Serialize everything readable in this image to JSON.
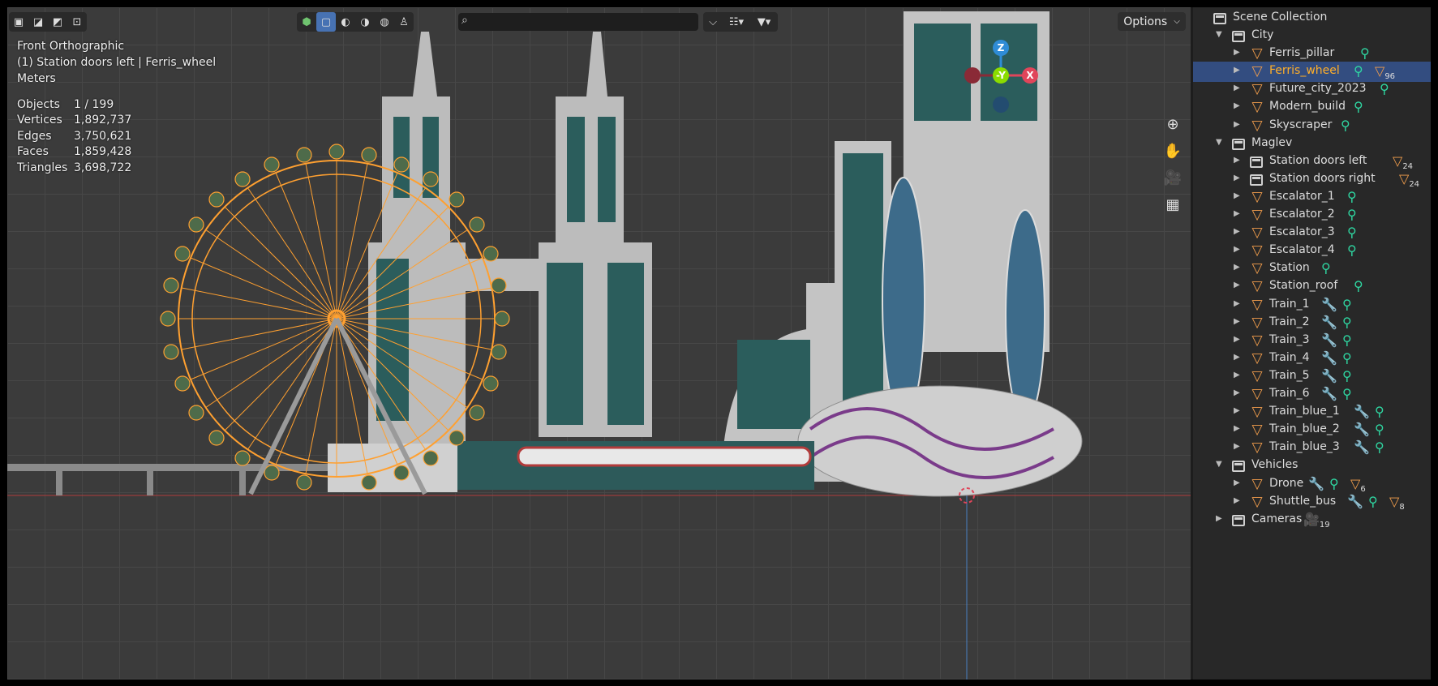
{
  "viewport": {
    "view_name": "Front Orthographic",
    "active_object": "(1) Station doors left | Ferris_wheel",
    "units": "Meters",
    "stats": [
      {
        "label": "Objects",
        "value": "1 / 199"
      },
      {
        "label": "Vertices",
        "value": "1,892,737"
      },
      {
        "label": "Edges",
        "value": "3,750,621"
      },
      {
        "label": "Faces",
        "value": "1,859,428"
      },
      {
        "label": "Triangles",
        "value": "3,698,722"
      }
    ],
    "options_label": "Options",
    "search_placeholder": "",
    "gizmo": {
      "z": "Z",
      "y": "-Y",
      "x": "X"
    },
    "colors": {
      "selection": "#ffa030",
      "background": "#3b3b3b",
      "x_axis": "#e0455a",
      "y_axis": "#8bdc00",
      "z_axis": "#2f8cd6"
    }
  },
  "outliner": {
    "root": "Scene Collection",
    "rows": [
      {
        "label": "City",
        "kind": "collection",
        "depth": 1,
        "expanded": true,
        "tails": []
      },
      {
        "label": "Ferris_pillar",
        "kind": "object",
        "depth": 2,
        "tails": [
          {
            "icon": "mesh-data-icon",
            "color": "green"
          }
        ]
      },
      {
        "label": "Ferris_wheel",
        "kind": "object",
        "depth": 2,
        "selected": true,
        "tails": [
          {
            "icon": "mesh-data-icon",
            "color": "green"
          },
          {
            "icon": "children-icon",
            "color": "orange",
            "count": "96"
          }
        ]
      },
      {
        "label": "Future_city_2023",
        "kind": "object",
        "depth": 2,
        "tails": [
          {
            "icon": "mesh-data-icon",
            "color": "green"
          }
        ]
      },
      {
        "label": "Modern_build",
        "kind": "object",
        "depth": 2,
        "tails": [
          {
            "icon": "mesh-data-icon",
            "color": "green"
          }
        ]
      },
      {
        "label": "Skyscraper",
        "kind": "object",
        "depth": 2,
        "tails": [
          {
            "icon": "mesh-data-icon",
            "color": "green"
          }
        ]
      },
      {
        "label": "Maglev",
        "kind": "collection",
        "depth": 1,
        "expanded": true,
        "tails": []
      },
      {
        "label": "Station doors left",
        "kind": "collection",
        "depth": 2,
        "tails": [
          {
            "icon": "children-icon",
            "color": "orange",
            "count": "24"
          }
        ]
      },
      {
        "label": "Station doors right",
        "kind": "collection",
        "depth": 2,
        "tails": [
          {
            "icon": "children-icon",
            "color": "orange",
            "count": "24"
          }
        ]
      },
      {
        "label": "Escalator_1",
        "kind": "object",
        "depth": 2,
        "tails": [
          {
            "icon": "mesh-data-icon",
            "color": "green"
          }
        ]
      },
      {
        "label": "Escalator_2",
        "kind": "object",
        "depth": 2,
        "tails": [
          {
            "icon": "mesh-data-icon",
            "color": "green"
          }
        ]
      },
      {
        "label": "Escalator_3",
        "kind": "object",
        "depth": 2,
        "tails": [
          {
            "icon": "mesh-data-icon",
            "color": "green"
          }
        ]
      },
      {
        "label": "Escalator_4",
        "kind": "object",
        "depth": 2,
        "tails": [
          {
            "icon": "mesh-data-icon",
            "color": "green"
          }
        ]
      },
      {
        "label": "Station",
        "kind": "object",
        "depth": 2,
        "tails": [
          {
            "icon": "mesh-data-icon",
            "color": "green"
          }
        ]
      },
      {
        "label": "Station_roof",
        "kind": "object",
        "depth": 2,
        "tails": [
          {
            "icon": "mesh-data-icon",
            "color": "green"
          }
        ]
      },
      {
        "label": "Train_1",
        "kind": "object",
        "depth": 2,
        "tails": [
          {
            "icon": "modifier-icon",
            "color": "blue"
          },
          {
            "icon": "mesh-data-icon",
            "color": "green"
          }
        ]
      },
      {
        "label": "Train_2",
        "kind": "object",
        "depth": 2,
        "tails": [
          {
            "icon": "modifier-icon",
            "color": "blue"
          },
          {
            "icon": "mesh-data-icon",
            "color": "green"
          }
        ]
      },
      {
        "label": "Train_3",
        "kind": "object",
        "depth": 2,
        "tails": [
          {
            "icon": "modifier-icon",
            "color": "blue"
          },
          {
            "icon": "mesh-data-icon",
            "color": "green"
          }
        ]
      },
      {
        "label": "Train_4",
        "kind": "object",
        "depth": 2,
        "tails": [
          {
            "icon": "modifier-icon",
            "color": "blue"
          },
          {
            "icon": "mesh-data-icon",
            "color": "green"
          }
        ]
      },
      {
        "label": "Train_5",
        "kind": "object",
        "depth": 2,
        "tails": [
          {
            "icon": "modifier-icon",
            "color": "blue"
          },
          {
            "icon": "mesh-data-icon",
            "color": "green"
          }
        ]
      },
      {
        "label": "Train_6",
        "kind": "object",
        "depth": 2,
        "tails": [
          {
            "icon": "modifier-icon",
            "color": "blue"
          },
          {
            "icon": "mesh-data-icon",
            "color": "green"
          }
        ]
      },
      {
        "label": "Train_blue_1",
        "kind": "object",
        "depth": 2,
        "tails": [
          {
            "icon": "modifier-icon",
            "color": "blue"
          },
          {
            "icon": "mesh-data-icon",
            "color": "green"
          }
        ]
      },
      {
        "label": "Train_blue_2",
        "kind": "object",
        "depth": 2,
        "tails": [
          {
            "icon": "modifier-icon",
            "color": "blue"
          },
          {
            "icon": "mesh-data-icon",
            "color": "green"
          }
        ]
      },
      {
        "label": "Train_blue_3",
        "kind": "object",
        "depth": 2,
        "tails": [
          {
            "icon": "modifier-icon",
            "color": "blue"
          },
          {
            "icon": "mesh-data-icon",
            "color": "green"
          }
        ]
      },
      {
        "label": "Vehicles",
        "kind": "collection",
        "depth": 1,
        "expanded": true,
        "tails": []
      },
      {
        "label": "Drone",
        "kind": "object",
        "depth": 2,
        "tails": [
          {
            "icon": "modifier-icon",
            "color": "blue"
          },
          {
            "icon": "mesh-data-icon",
            "color": "green"
          },
          {
            "icon": "children-icon",
            "color": "orange",
            "count": "6"
          }
        ]
      },
      {
        "label": "Shuttle_bus",
        "kind": "object",
        "depth": 2,
        "tails": [
          {
            "icon": "modifier-icon",
            "color": "blue"
          },
          {
            "icon": "mesh-data-icon",
            "color": "green"
          },
          {
            "icon": "children-icon",
            "color": "orange",
            "count": "8"
          }
        ]
      },
      {
        "label": "Cameras",
        "kind": "collection",
        "depth": 1,
        "expanded": false,
        "tails": [
          {
            "icon": "camera-group-icon",
            "color": "orange",
            "count": "19"
          }
        ]
      }
    ]
  }
}
